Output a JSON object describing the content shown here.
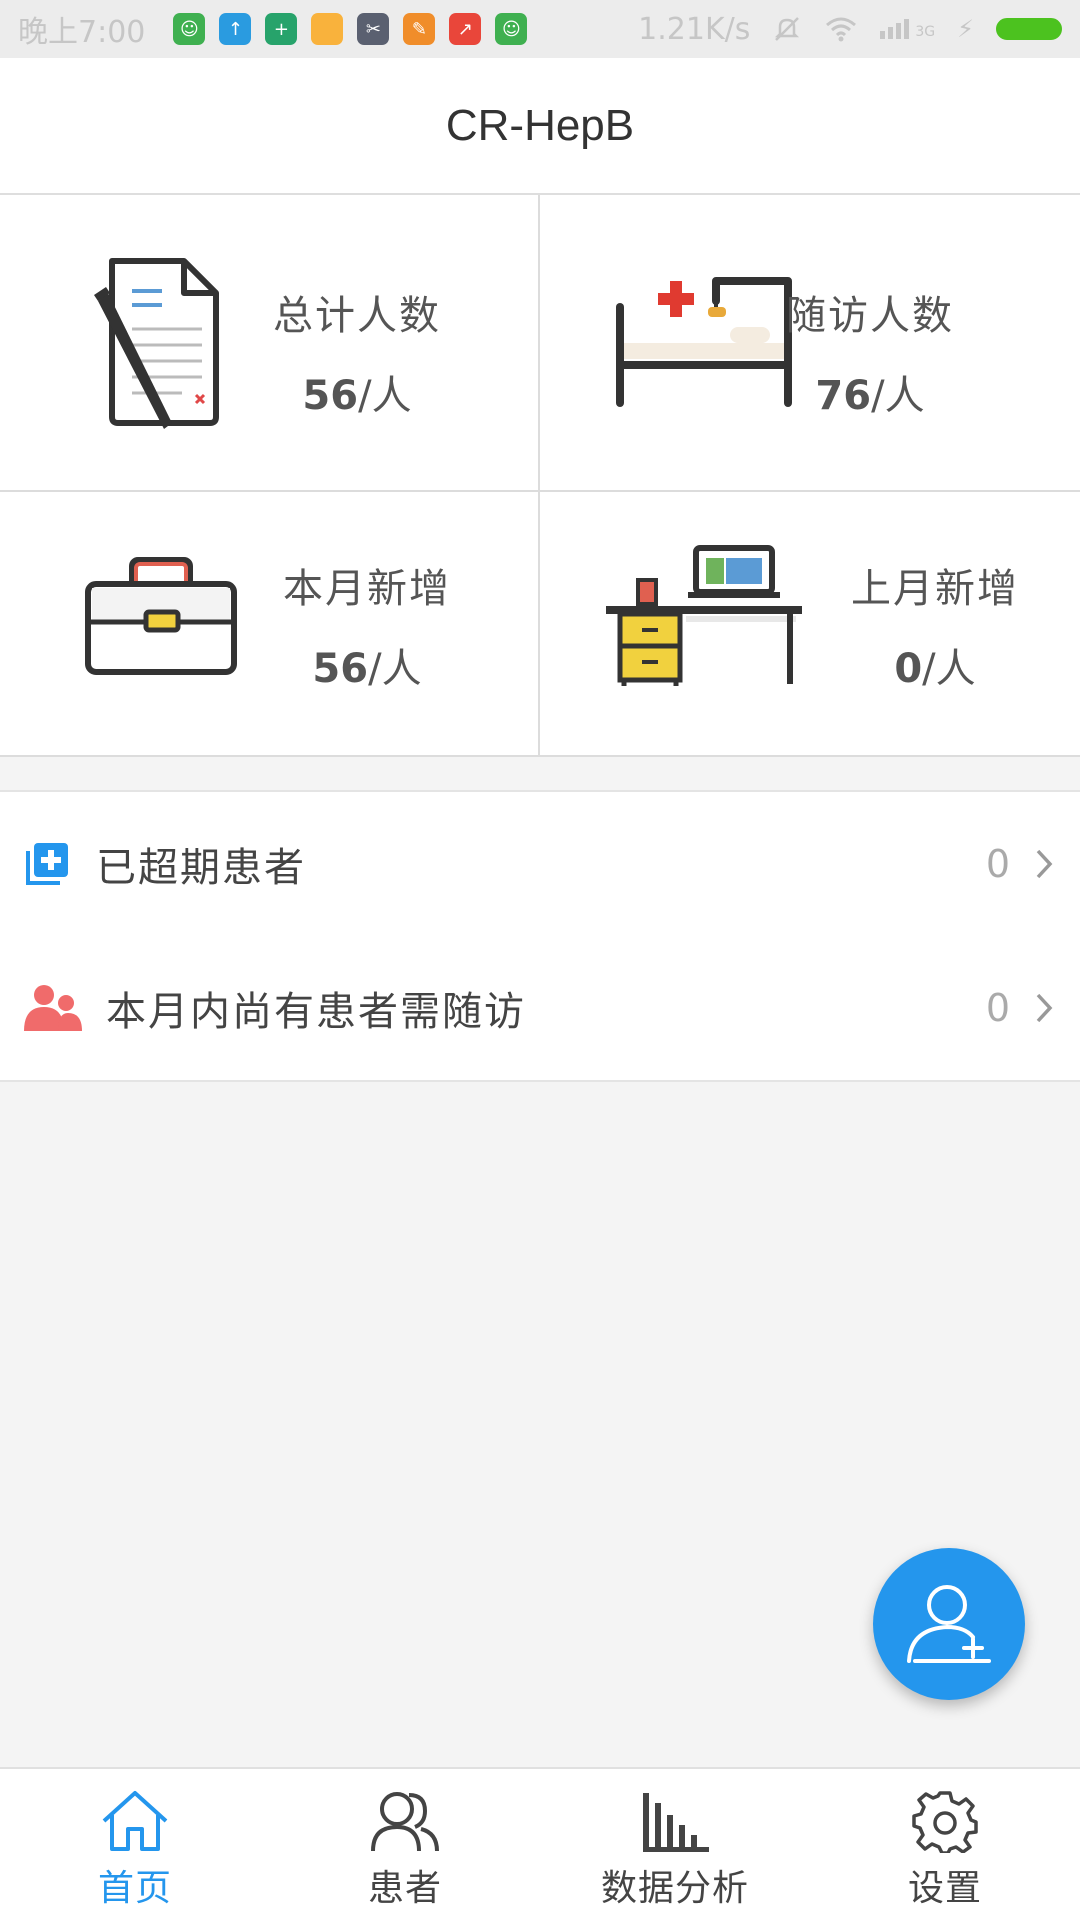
{
  "status_bar": {
    "time": "晚上7:00",
    "network_speed": "1.21K/s",
    "network_type": "3G"
  },
  "header": {
    "title": "CR-HepB"
  },
  "stats": [
    {
      "label": "总计人数",
      "value": "56",
      "unit": "/人",
      "icon": "document-pen-icon"
    },
    {
      "label": "随访人数",
      "value": "76",
      "unit": "/人",
      "icon": "hospital-bed-icon"
    },
    {
      "label": "本月新增",
      "value": "56",
      "unit": "/人",
      "icon": "briefcase-icon"
    },
    {
      "label": "上月新增",
      "value": "0",
      "unit": "/人",
      "icon": "desk-laptop-icon"
    }
  ],
  "list": [
    {
      "label": "已超期患者",
      "count": "0",
      "icon": "add-copy-icon",
      "icon_color": "#2496ed"
    },
    {
      "label": "本月内尚有患者需随访",
      "count": "0",
      "icon": "people-icon",
      "icon_color": "#f06b6b"
    }
  ],
  "fab": {
    "icon": "add-user-icon",
    "color": "#2496ed"
  },
  "bottom_nav": [
    {
      "label": "首页",
      "icon": "home-icon",
      "active": true
    },
    {
      "label": "患者",
      "icon": "patients-icon",
      "active": false
    },
    {
      "label": "数据分析",
      "icon": "bar-chart-icon",
      "active": false
    },
    {
      "label": "设置",
      "icon": "gear-icon",
      "active": false
    }
  ],
  "colors": {
    "accent": "#2496ed",
    "alert": "#f06b6b",
    "background": "#f4f4f4"
  }
}
